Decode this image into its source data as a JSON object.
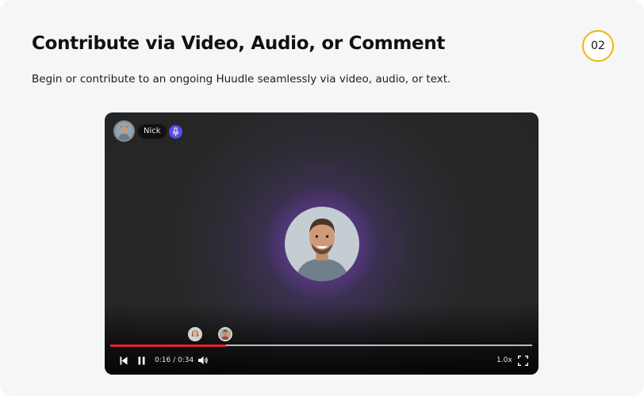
{
  "header": {
    "title": "Contribute via Video, Audio, or Comment",
    "step_number": "02",
    "description": "Begin or contribute to an ongoing Huudle seamlessly via video, audio, or text."
  },
  "player": {
    "participant": {
      "name": "Nick",
      "avatar_icon": "user-avatar",
      "mic_icon": "mic-icon",
      "mic_color": "#5b4bf0"
    },
    "speaker_icon": "speaker-avatar",
    "comment_markers": [
      {
        "icon": "commenter-avatar-woman"
      },
      {
        "icon": "commenter-avatar-man"
      }
    ],
    "progress": {
      "current_time": "0:16",
      "duration": "0:34",
      "fraction": 0.275,
      "fill_color": "#e8232d"
    },
    "controls": {
      "time_label": "0:16 / 0:34",
      "speed_label": "1.0x",
      "previous_icon": "skip-back-icon",
      "pause_icon": "pause-icon",
      "volume_icon": "volume-icon",
      "fullscreen_icon": "fullscreen-icon"
    }
  },
  "colors": {
    "card_background": "#f5f6f8",
    "badge_border": "#f2b600",
    "player_background": "#252525"
  }
}
